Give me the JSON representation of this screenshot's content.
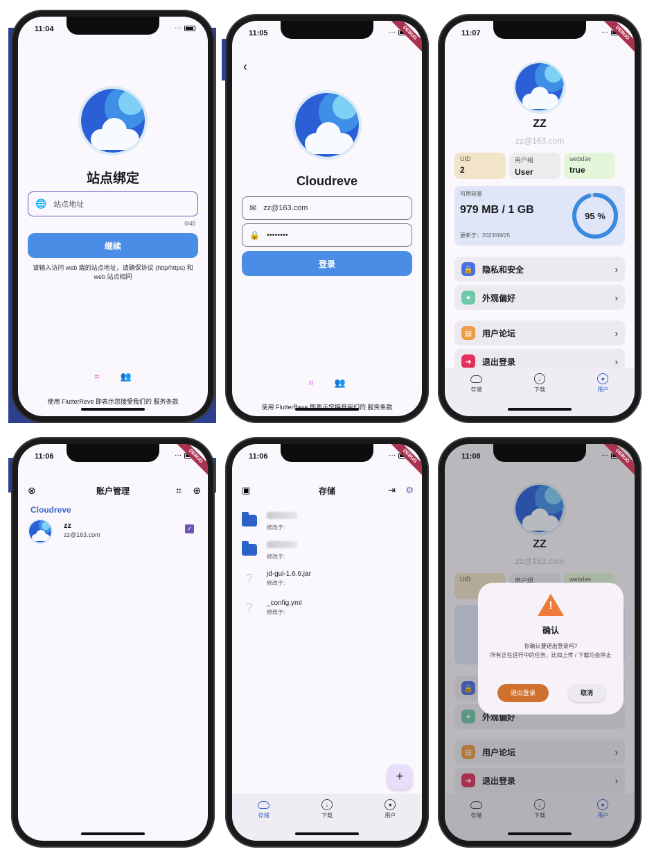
{
  "status_times": [
    "11:04",
    "11:05",
    "11:07",
    "11:06",
    "11:06",
    "11:08"
  ],
  "debug_label": "DEBUG",
  "screen1": {
    "title": "站点绑定",
    "placeholder": "站点地址",
    "counter": "0/40",
    "button": "继续",
    "hint": "请输入访问 web 端的站点地址，请确保协议 (http/https) 和 web 站点相同",
    "footer": "使用 FlutterReve 即表示您接受我们的 服务条款"
  },
  "screen2": {
    "title": "Cloudreve",
    "email": "zz@163.com",
    "password": "••••••••",
    "button": "登录",
    "footer": "使用 FlutterReve 即表示您接受我们的 服务条款"
  },
  "screen3": {
    "name": "ZZ",
    "email": "zz@163.com",
    "uid_label": "UID",
    "uid_value": "2",
    "group_label": "用户组",
    "group_value": "User",
    "webdav_label": "webdav",
    "webdav_value": "true",
    "capacity_label": "可用容量",
    "capacity_value": "979 MB / 1 GB",
    "updated": "更新于：2023/09/25",
    "percent_text": "95 %",
    "percent": 0.95,
    "menu": [
      "隐私和安全",
      "外观偏好",
      "用户论坛",
      "退出登录"
    ]
  },
  "screen4": {
    "title": "账户管理",
    "site": "Cloudreve",
    "account_name": "zz",
    "account_email": "zz@163.com"
  },
  "screen5": {
    "title": "存储",
    "files": [
      {
        "name": "",
        "sub": "修改于:",
        "kind": "folder"
      },
      {
        "name": "",
        "sub": "修改于:",
        "kind": "folder"
      },
      {
        "name": "jd-gui-1.6.6.jar",
        "sub": "修改于:",
        "kind": "unknown"
      },
      {
        "name": "_config.yml",
        "sub": "修改于:",
        "kind": "unknown"
      }
    ],
    "fab": "+"
  },
  "screen6": {
    "dialog_title": "确认",
    "dialog_body_1": "你确认要退出登录吗?",
    "dialog_body_2": "所有正在运行中的任务，比如上传 / 下载均会停止",
    "confirm": "退出登录",
    "cancel": "取消"
  },
  "nav": [
    "存储",
    "下载",
    "用户"
  ],
  "colors": {
    "primary": "#4a8de6",
    "nav_active": "#3b67c8",
    "uid_card": "#f1e4c9",
    "group_card": "#ececef",
    "webdav_card": "#e3f6d9",
    "capacity_card": "#dfe6f8",
    "logout_button": "#d0702e"
  }
}
